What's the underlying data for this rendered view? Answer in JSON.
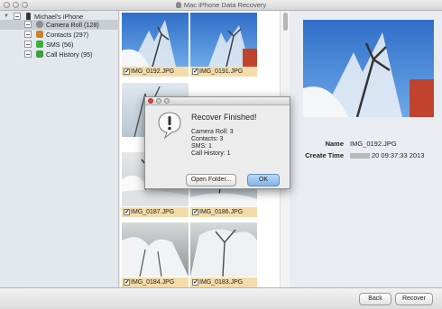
{
  "window": {
    "title": "Mac iPhone Data Recovery"
  },
  "sidebar": {
    "device": "Michael's iPhone",
    "items": [
      {
        "label": "Camera Roll (128)",
        "icon": "camera-roll-icon",
        "color": "#8c8c8c"
      },
      {
        "label": "Contacts (297)",
        "icon": "contacts-icon",
        "color": "#c8822c"
      },
      {
        "label": "SMS (56)",
        "icon": "sms-icon",
        "color": "#3cae3c"
      },
      {
        "label": "Call History (95)",
        "icon": "call-history-icon",
        "color": "#3aa23a"
      }
    ]
  },
  "grid": {
    "items": [
      {
        "name": "IMG_0192.JPG",
        "checked": "✓"
      },
      {
        "name": "IMG_0191.JPG",
        "checked": "✓"
      },
      {
        "name": "IMG_0187.JPG",
        "checked": "✓"
      },
      {
        "name": "IMG_0186.JPG",
        "checked": "✓"
      },
      {
        "name": "IMG_0184.JPG",
        "checked": "✓"
      },
      {
        "name": "IMG_0183.JPG",
        "checked": "✓"
      }
    ]
  },
  "preview": {
    "name_label": "Name",
    "name_value": "IMG_0192.JPG",
    "time_label": "Create Time",
    "time_value": "20 09:37:33 2013"
  },
  "dialog": {
    "title": "Recover Finished!",
    "lines": [
      "Camera Roll: 3",
      "Contacts: 3",
      "SMS: 1",
      "Call History: 1"
    ],
    "open_folder": "Open Folder...",
    "ok": "OK"
  },
  "footer": {
    "back": "Back",
    "recover": "Recover"
  },
  "colors": {
    "caption_highlight": "#f4dba9",
    "ok_button": "#7fb3ea"
  }
}
